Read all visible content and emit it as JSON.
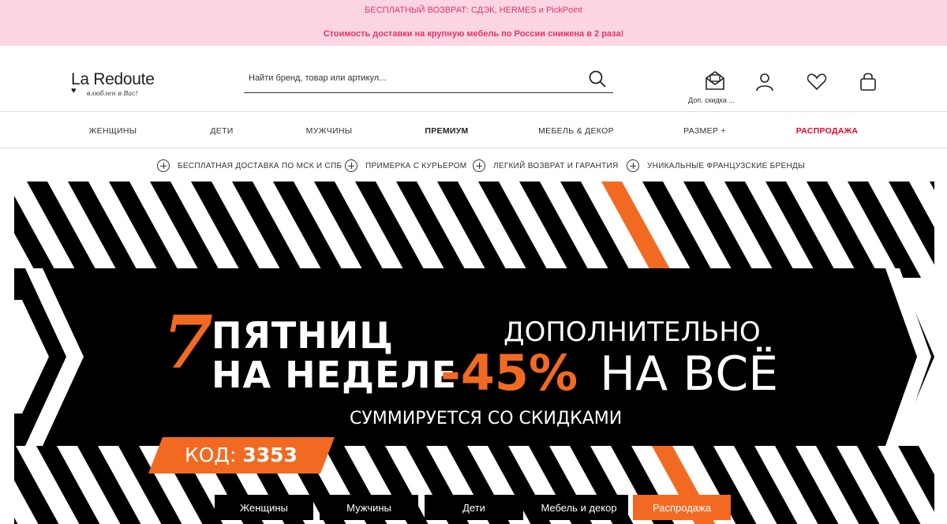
{
  "promo": {
    "line1": "БЕСПЛАТНЫЙ ВОЗВРАТ: СДЭК, HERMES и PickPoint",
    "line2": "Стоимость доставки на крупную мебель по России снижена в 2 раза!"
  },
  "header": {
    "logo": "La Redoute",
    "tagline": "влюблен в Вас!",
    "search_placeholder": "Найти бренд, товар или артикул...",
    "discount_label": "Доп. скидка ...",
    "icons": [
      "search-icon",
      "mail-icon",
      "user-icon",
      "heart-icon",
      "bag-icon"
    ]
  },
  "nav": {
    "items": [
      "ЖЕНЩИНЫ",
      "ДЕТИ",
      "МУЖЧИНЫ",
      "ПРЕМИУМ",
      "МЕБЕЛЬ & ДЕКОР",
      "РАЗМЕР +",
      "РАСПРОДАЖА"
    ]
  },
  "benefits": [
    "БЕСПЛАТНАЯ ДОСТАВКА ПО МСК И СПБ",
    "ПРИМЕРКА С КУРЬЕРОМ",
    "ЛЕГКИЙ ВОЗВРАТ И ГАРАНТИЯ",
    "УНИКАЛЬНЫЕ ФРАНЦУЗСКИЕ БРЕНДЫ"
  ],
  "banner": {
    "number": "7",
    "line1": "ПЯТНИЦ",
    "line2": "НА НЕДЕЛЕ",
    "extra": "ДОПОЛНИТЕЛЬНО",
    "discount": "-45%",
    "on_all": "НА ВСЁ",
    "note": "СУММИРУЕТСЯ СО СКИДКАМИ",
    "code_label": "КОД:",
    "code_value": "3353",
    "categories": [
      "Женщины",
      "Мужчины",
      "Дети",
      "Мебель и декор",
      "Распродажа"
    ]
  },
  "colors": {
    "promo_bg": "#fbd6e0",
    "promo_text": "#e2336b",
    "sale_red": "#e2062b",
    "accent_orange": "#f26a22",
    "banner_black": "#000000"
  }
}
